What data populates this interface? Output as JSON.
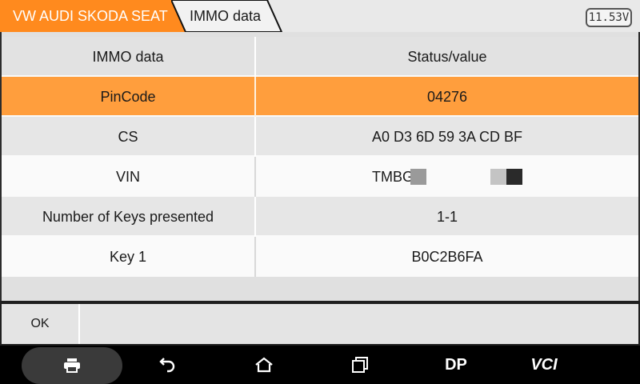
{
  "header": {
    "breadcrumbs": [
      {
        "label": "VW AUDI SKODA SEAT"
      },
      {
        "label": "IMMO data"
      }
    ],
    "voltage": "11.53V",
    "colors": {
      "active_crumb": "#ff8a1e",
      "crumb": "#f2f2f2"
    }
  },
  "table": {
    "columns": [
      "IMMO data",
      "Status/value"
    ],
    "rows": [
      {
        "label": "PinCode",
        "value": "04276",
        "selected": true
      },
      {
        "label": "CS",
        "value": "A0 D3 6D 59 3A CD BF"
      },
      {
        "label": "VIN",
        "value": "TMBG",
        "redacted": true
      },
      {
        "label": "Number of Keys presented",
        "value": "1-1"
      },
      {
        "label": "Key 1",
        "value": "B0C2B6FA"
      }
    ],
    "colors": {
      "selected": "#ff9e3d"
    }
  },
  "actions": {
    "ok_label": "OK"
  },
  "navbar": {
    "items": [
      {
        "icon": "print-icon"
      },
      {
        "icon": "back-arrow-icon"
      },
      {
        "icon": "home-icon"
      },
      {
        "icon": "recent-apps-icon"
      },
      {
        "label": "DP"
      },
      {
        "label": "VCI"
      }
    ]
  }
}
